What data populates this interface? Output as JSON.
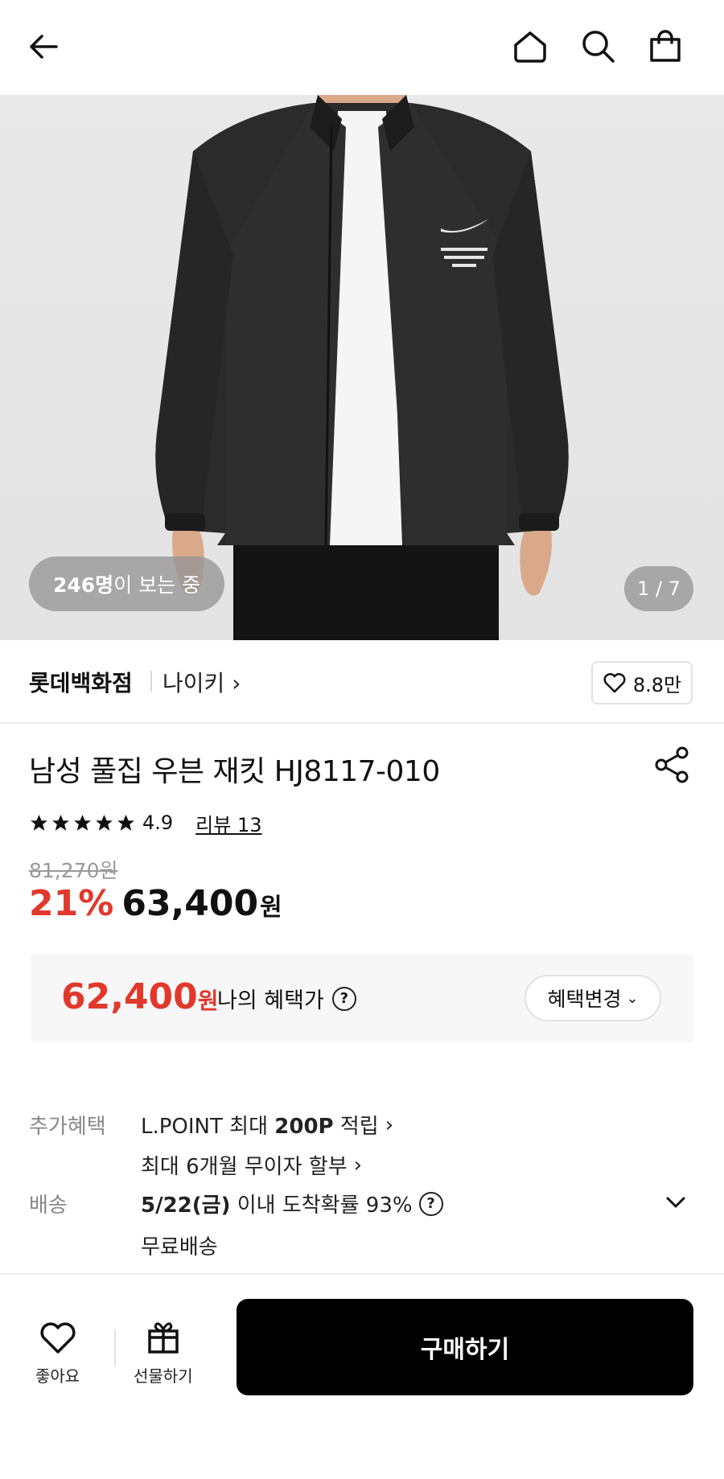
{
  "header": {
    "icons": {
      "back": "arrow-left-icon",
      "home": "home-icon",
      "search": "search-icon",
      "cart": "shopping-bag-icon"
    }
  },
  "hero": {
    "viewers_count": "246명",
    "viewers_suffix": "이 보는 중",
    "pager": "1 / 7"
  },
  "store": {
    "name": "롯데백화점",
    "brand": "나이키",
    "likes": "8.8만"
  },
  "product": {
    "title": "남성 풀집 우븐 재킷 HJ8117-010",
    "rating": "4.9",
    "review_label": "리뷰 13",
    "stars": 5,
    "original_price": "81,270원",
    "discount": "21%",
    "price": "63,400",
    "currency": "원"
  },
  "benefit": {
    "price": "62,400",
    "currency": "원",
    "label": "나의 혜택가",
    "change_label": "혜택변경"
  },
  "extra": {
    "label": "추가혜택",
    "line1_prefix": "L.POINT 최대 ",
    "line1_bold": "200P",
    "line1_suffix": " 적립",
    "line2": "최대 6개월 무이자 할부"
  },
  "shipping": {
    "label": "배송",
    "date": "5/22(금)",
    "desc": " 이내 도착확률 93%",
    "fee": "무료배송"
  },
  "bottom": {
    "like_label": "좋아요",
    "gift_label": "선물하기",
    "buy_label": "구매하기"
  },
  "colors": {
    "accent_red": "#e2382b",
    "buy_button": "#000000"
  }
}
